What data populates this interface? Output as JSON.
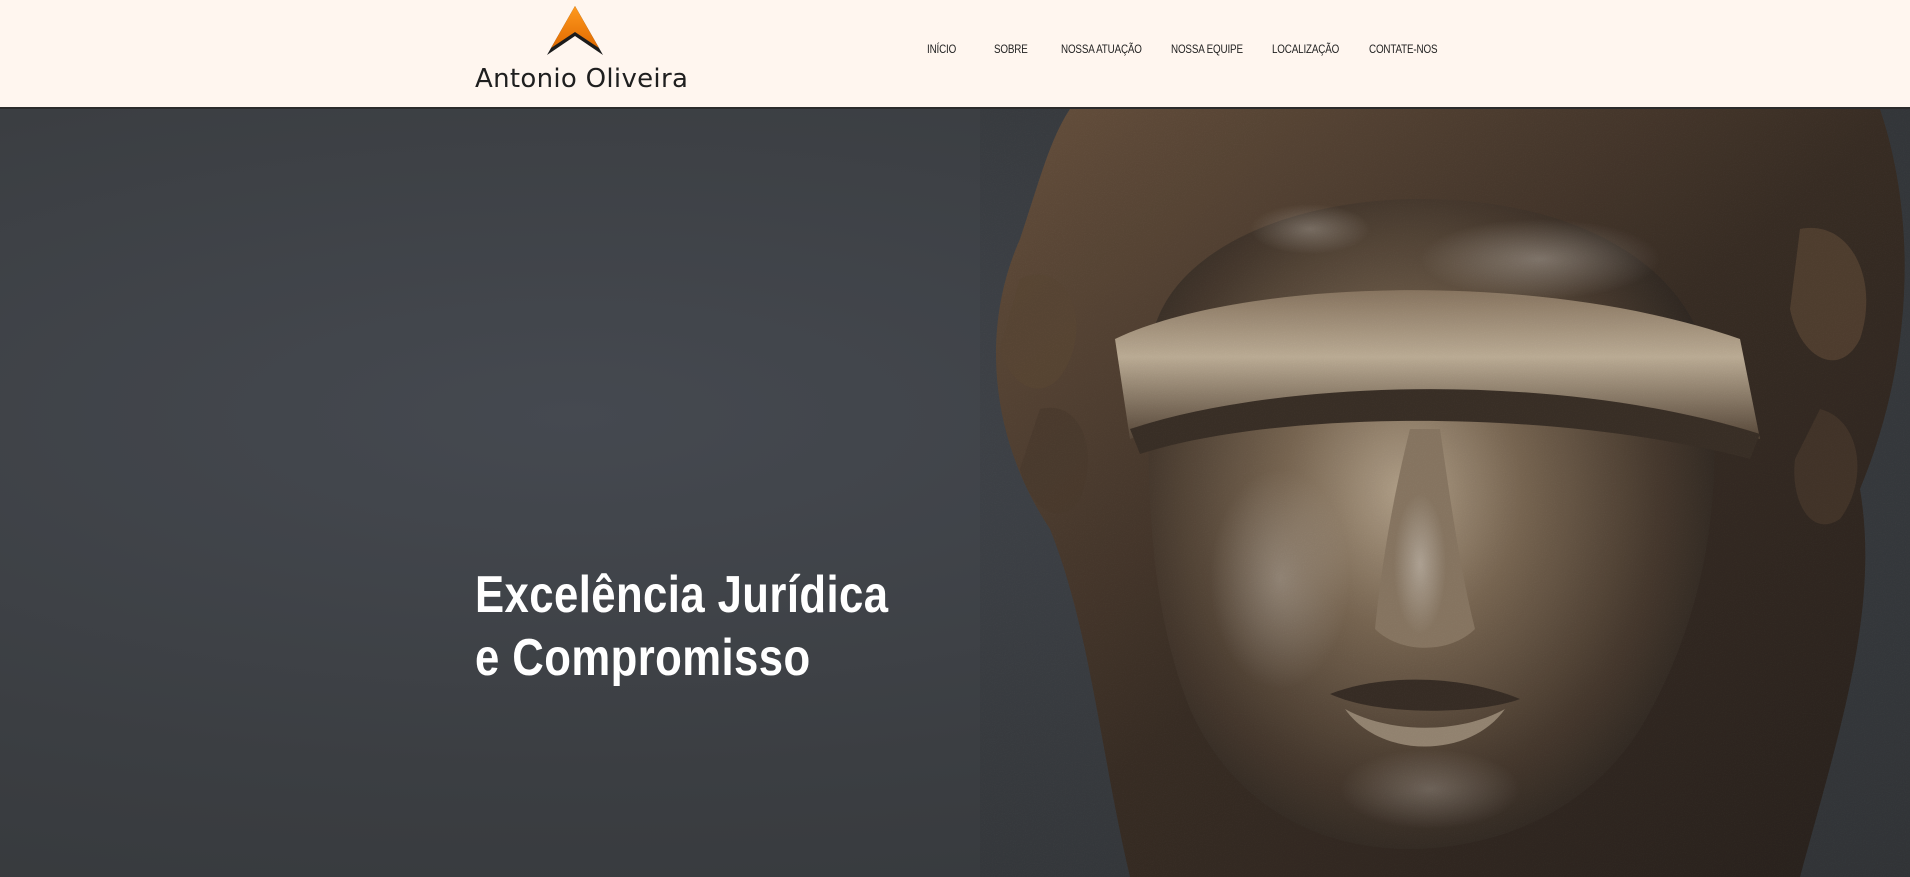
{
  "header": {
    "brand": "Antonio Oliveira",
    "logo_icon": "mountain-peak-icon",
    "nav": [
      {
        "label": "INÍCIO"
      },
      {
        "label": "SOBRE"
      },
      {
        "label": "NOSSA ATUAÇÃO"
      },
      {
        "label": "NOSSA EQUIPE"
      },
      {
        "label": "LOCALIZAÇÃO"
      },
      {
        "label": "CONTATE-NOS"
      }
    ]
  },
  "hero": {
    "title_line1": "Excelência Jurídica",
    "title_line2": "e Compromisso",
    "image": "blindfolded-justice-statue"
  },
  "colors": {
    "header_bg": "#fff6ef",
    "accent": "#f28c1a",
    "hero_bg": "#3a3d40",
    "bronze": "#8a6a4a"
  }
}
